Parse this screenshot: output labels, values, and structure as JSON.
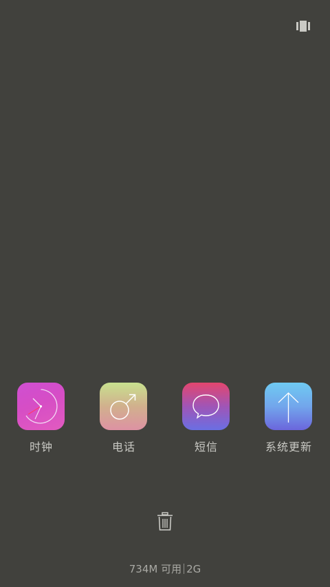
{
  "top_right_icon": "recent-layout-icon",
  "apps": [
    {
      "label": "时钟",
      "icon": "clock-icon",
      "color": "#d64ec5"
    },
    {
      "label": "电话",
      "icon": "male-symbol-icon",
      "color": "#d1b08d"
    },
    {
      "label": "短信",
      "icon": "chat-bubble-icon",
      "color": "#a055b6"
    },
    {
      "label": "系统更新",
      "icon": "arrow-up-icon",
      "color": "#72a6ec"
    }
  ],
  "trash_icon": "trash-icon",
  "memory": {
    "available": "734M 可用",
    "total": "2G"
  },
  "colors": {
    "background": "#41413d",
    "label_text": "#c9c9c4"
  }
}
